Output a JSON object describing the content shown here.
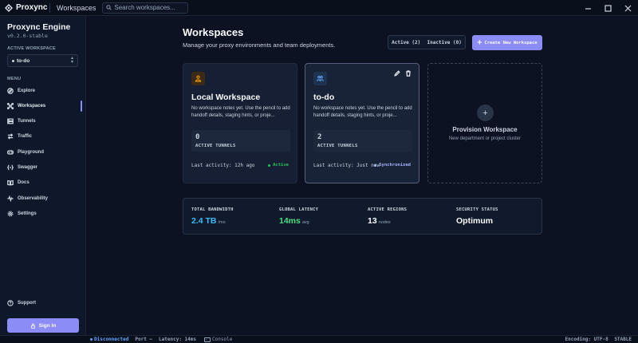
{
  "titlebar": {
    "app_name": "Proxync",
    "breadcrumb": "Workspaces",
    "search_placeholder": "Search workspaces..."
  },
  "sidebar": {
    "brand": "Proxync Engine",
    "version": "v0.2.0-stable",
    "active_workspace_label": "ACTIVE WORKSPACE",
    "active_workspace_value": "to-do",
    "menu_label": "MENU",
    "items": [
      {
        "label": "Explore",
        "icon": "compass-icon"
      },
      {
        "label": "Workspaces",
        "icon": "network-icon",
        "active": true
      },
      {
        "label": "Tunnels",
        "icon": "tunnel-icon"
      },
      {
        "label": "Traffic",
        "icon": "traffic-icon"
      },
      {
        "label": "Playground",
        "icon": "gamepad-icon"
      },
      {
        "label": "Swagger",
        "icon": "swagger-icon"
      },
      {
        "label": "Docs",
        "icon": "book-icon"
      },
      {
        "label": "Observability",
        "icon": "pulse-icon"
      },
      {
        "label": "Settings",
        "icon": "gear-icon"
      }
    ],
    "support_label": "Support",
    "signin_label": "Sign In"
  },
  "main": {
    "title": "Workspaces",
    "subtitle": "Manage your proxy environments and team deployments.",
    "filter_active": "Active (2)",
    "filter_inactive": "Inactive (0)",
    "create_label": "Create New Workspace",
    "cards": [
      {
        "title": "Local Workspace",
        "notes": "No workspace notes yet. Use the pencil to add handoff details, staging hints, or proje...",
        "tunnels": "0",
        "tunnels_label": "ACTIVE TUNNELS",
        "activity": "Last activity: 12h ago",
        "status": "Active",
        "status_color": "#22c55e",
        "icon_color": "#f59e0b"
      },
      {
        "title": "to-do",
        "notes": "No workspace notes yet. Use the pencil to add handoff details, staging hints, or proje...",
        "tunnels": "2",
        "tunnels_label": "ACTIVE TUNNELS",
        "activity": "Last activity: Just now",
        "status": "Synchronized",
        "status_color": "#a5b4fc",
        "icon_color": "#60a5fa"
      }
    ],
    "provision_title": "Provision Workspace",
    "provision_sub": "New department or project cluster",
    "stats": [
      {
        "label": "TOTAL BANDWIDTH",
        "value": "2.4 TB",
        "unit": "/mo",
        "color": "#38bdf8"
      },
      {
        "label": "GLOBAL LATENCY",
        "value": "14ms",
        "unit": "avg",
        "color": "#4ade80"
      },
      {
        "label": "ACTIVE REGIONS",
        "value": "13",
        "unit": "nodes",
        "color": "#f8fafc"
      },
      {
        "label": "SECURITY STATUS",
        "value": "Optimum",
        "unit": "",
        "color": "#f8fafc"
      }
    ]
  },
  "statusbar": {
    "connection": "Disconnected",
    "port": "Port —",
    "latency": "Latency: 14ms",
    "console": "Console",
    "encoding": "Encoding: UTF-8",
    "channel": "STABLE"
  }
}
